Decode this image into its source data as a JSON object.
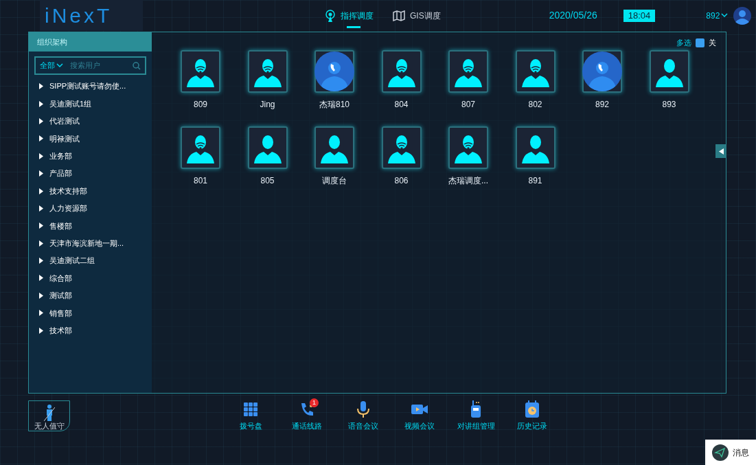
{
  "header": {
    "logo": "iNexT",
    "tabs": [
      {
        "label": "指挥调度",
        "selected": true,
        "kind": "radar"
      },
      {
        "label": "GIS调度",
        "selected": false,
        "kind": "map"
      }
    ],
    "date": "2020/05/26",
    "time": "18:04",
    "user": "892"
  },
  "sidebar": {
    "title": "组织架构",
    "filter": "全部",
    "search": {
      "placeholder": "搜索用户"
    },
    "items": [
      {
        "label": "SIPP测试账号请勿使..."
      },
      {
        "label": "吴迪测试1组"
      },
      {
        "label": "代岩测试"
      },
      {
        "label": "明禄测试"
      },
      {
        "label": "业务部"
      },
      {
        "label": "产品部"
      },
      {
        "label": "技术支持部"
      },
      {
        "label": "人力资源部"
      },
      {
        "label": "售楼部"
      },
      {
        "label": "天津市海滨新地一期..."
      },
      {
        "label": "吴迪测试二组"
      },
      {
        "label": "综合部"
      },
      {
        "label": "测试部"
      },
      {
        "label": "销售部"
      },
      {
        "label": "技术部"
      }
    ]
  },
  "multiselect": {
    "label": "多选",
    "state": "关",
    "on": false
  },
  "contacts": [
    {
      "name": "809",
      "kind": "wifi"
    },
    {
      "name": "Jing",
      "kind": "wifi"
    },
    {
      "name": "杰瑞810",
      "kind": "calling"
    },
    {
      "name": "804",
      "kind": "wifi"
    },
    {
      "name": "807",
      "kind": "wifi"
    },
    {
      "name": "802",
      "kind": "wifi"
    },
    {
      "name": "892",
      "kind": "calling"
    },
    {
      "name": "893",
      "kind": "plain"
    },
    {
      "name": "801",
      "kind": "wifi"
    },
    {
      "name": "805",
      "kind": "plain"
    },
    {
      "name": "调度台",
      "kind": "plain"
    },
    {
      "name": "806",
      "kind": "wifi"
    },
    {
      "name": "杰瑞调度...",
      "kind": "wifi"
    },
    {
      "name": "891",
      "kind": "plain"
    }
  ],
  "duty": {
    "label": "无人值守"
  },
  "toolbar": [
    {
      "label": "拨号盘",
      "kind": "dialpad"
    },
    {
      "label": "通话线路",
      "kind": "phone",
      "badge": "1"
    },
    {
      "label": "语音会议",
      "kind": "mic"
    },
    {
      "label": "视频会议",
      "kind": "video"
    },
    {
      "label": "对讲组管理",
      "kind": "walkie"
    },
    {
      "label": "历史记录",
      "kind": "history"
    }
  ],
  "message": {
    "label": "消息"
  }
}
